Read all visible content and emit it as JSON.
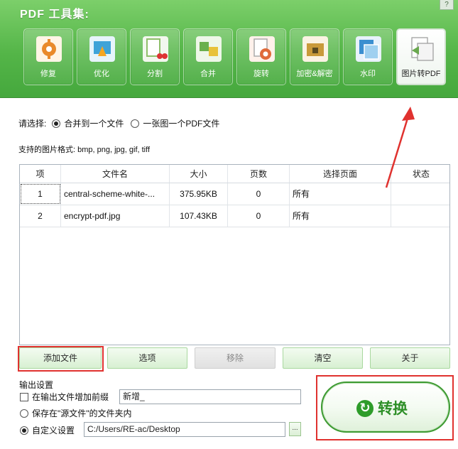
{
  "app": {
    "title": "PDF 工具集:",
    "help": "?"
  },
  "toolbar": [
    {
      "label": "修复",
      "icon": "repair-icon",
      "color": "#e98a2b"
    },
    {
      "label": "优化",
      "icon": "optimize-icon",
      "color": "#3fa3d8"
    },
    {
      "label": "分割",
      "icon": "split-icon",
      "color": "#8fbf6a"
    },
    {
      "label": "合并",
      "icon": "merge-icon",
      "color": "#6ab04c"
    },
    {
      "label": "旋转",
      "icon": "rotate-icon",
      "color": "#e06a3a"
    },
    {
      "label": "加密&解密",
      "icon": "encrypt-icon",
      "color": "#c99a3a"
    },
    {
      "label": "水印",
      "icon": "watermark-icon",
      "color": "#3b8fd0"
    },
    {
      "label": "图片转PDF",
      "icon": "image-to-pdf-icon",
      "color": "#6aa84f",
      "active": true
    }
  ],
  "selection": {
    "prompt": "请选择:",
    "option_merge": "合并到一个文件",
    "option_each": "一张图一个PDF文件"
  },
  "formats": "支持的图片格式: bmp, png, jpg, gif, tiff",
  "table": {
    "columns": [
      "项",
      "文件名",
      "大小",
      "页数",
      "选择页面",
      "状态"
    ],
    "rows": [
      {
        "index": "1",
        "name": "central-scheme-white-...",
        "size": "375.95KB",
        "pages": "0",
        "range": "所有",
        "status": ""
      },
      {
        "index": "2",
        "name": "encrypt-pdf.jpg",
        "size": "107.43KB",
        "pages": "0",
        "range": "所有",
        "status": ""
      }
    ]
  },
  "buttons": {
    "add": "添加文件",
    "options": "选项",
    "remove": "移除",
    "clear": "清空",
    "about": "关于"
  },
  "output": {
    "title": "输出设置",
    "prefix_label": "在输出文件增加前缀",
    "prefix_value": "新增_",
    "save_source_label": "保存在\"源文件\"的文件夹内",
    "custom_label": "自定义设置",
    "custom_path": "C:/Users/RE-ac/Desktop",
    "browse": "..."
  },
  "convert": {
    "label": "转换",
    "icon": "refresh-icon"
  },
  "colors": {
    "header_green": "#54b548",
    "accent_red": "#e0322f",
    "convert_green": "#2e8f28"
  }
}
